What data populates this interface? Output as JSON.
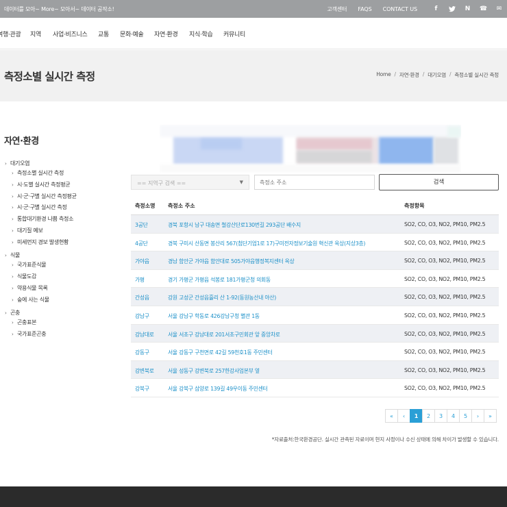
{
  "topbar": {
    "tagline": "데이터를 모아~ More~ 모아서~ 데이터 공작소!",
    "links": [
      "고객센터",
      "FAQS",
      "CONTACT US"
    ],
    "icons": [
      "facebook-icon",
      "twitter-icon",
      "naver-icon",
      "phone-icon",
      "mail-icon"
    ],
    "icon_glyphs": [
      "f",
      "✦",
      "N",
      "☎",
      "✉"
    ]
  },
  "nav": {
    "items": [
      "여행·관광",
      "지역",
      "사업·비즈니스",
      "교통",
      "문화·예술",
      "자연·환경",
      "지식·학습",
      "커뮤니티"
    ]
  },
  "banner": {
    "title": "측정소별 실시간 측정",
    "breadcrumb": [
      "Home",
      "자연·환경",
      "대기오염",
      "측정소별 실시간 측정"
    ],
    "separator": "/"
  },
  "sidebar": {
    "title": "자연·환경",
    "groups": [
      {
        "label": "대기오염",
        "items": [
          "측정소별 실시간 측정",
          "시·도별 실시간 측정평균",
          "시·군·구별 실시간 측정평균",
          "시·군·구별 실시간 측정",
          "통합대기환경 나쁨 측정소",
          "대기질 예보",
          "미세먼지 경보 발생현황"
        ]
      },
      {
        "label": "식물",
        "items": [
          "국가표준식물",
          "식물도감",
          "약용식물 목록",
          "숲에 사는 식물"
        ]
      },
      {
        "label": "곤충",
        "items": [
          "곤충표본",
          "국가표준곤충"
        ]
      }
    ]
  },
  "search": {
    "region_select": "== 지역구 검색 ==",
    "address_placeholder": "측정소 주소",
    "button_label": "검색"
  },
  "table": {
    "headers": [
      "측정소명",
      "측정소 주소",
      "측정항목"
    ],
    "rows": [
      [
        "3공단",
        "경북 포항시 남구 대송면 철강산단로130번길 293공단 배수지",
        "SO2, CO, O3, NO2, PM10, PM2.5"
      ],
      [
        "4공단",
        "경북 구미시 산동면 봉산리 567(첨단기업1로 17)구미전자정보기술원 혁신관 옥상(지상3층)",
        "SO2, CO, O3, NO2, PM10, PM2.5"
      ],
      [
        "가야읍",
        "경남 함안군 가야읍 함안대로 505가야읍행정복지센터 옥상",
        "SO2, CO, O3, NO2, PM10, PM2.5"
      ],
      [
        "가평",
        "경기 가평군 가평읍 석봉로 181가평군청 의회동",
        "SO2, CO, O3, NO2, PM10, PM2.5"
      ],
      [
        "간성읍",
        "강원 고성군 간성읍흘리 산 1-92(동원농산내 야산)",
        "SO2, CO, O3, NO2, PM10, PM2.5"
      ],
      [
        "강남구",
        "서울 강남구 학동로 426강남구청 별관 1동",
        "SO2, CO, O3, NO2, PM10, PM2.5"
      ],
      [
        "강남대로",
        "서울 서초구 강남대로 201서초구민회관 앞 중앙차로",
        "SO2, CO, O3, NO2, PM10, PM2.5"
      ],
      [
        "강동구",
        "서울 강동구 구천면로 42길 59천호1동 주민센터",
        "SO2, CO, O3, NO2, PM10, PM2.5"
      ],
      [
        "강변북로",
        "서울 성동구 강변북로 257한강사업본부 옆",
        "SO2, CO, O3, NO2, PM10, PM2.5"
      ],
      [
        "강북구",
        "서울 강북구 삼양로 139길 49우이동 주민센터",
        "SO2, CO, O3, NO2, PM10, PM2.5"
      ]
    ]
  },
  "pagination": {
    "first": "«",
    "prev": "‹",
    "pages": [
      "1",
      "2",
      "3",
      "4",
      "5"
    ],
    "current": "1",
    "next": "›",
    "last": "»"
  },
  "source_note": "*자료출처:한국환경공단. 실시간 관측된 자료이며 현지 사정이나 수신 상태에 의해 차이가 발생할 수 있습니다.",
  "colors": {
    "topbar": "#9d9fa1",
    "link": "#1a8fc8",
    "accent": "#2a9fd6",
    "footer": "#2b2b2b"
  }
}
